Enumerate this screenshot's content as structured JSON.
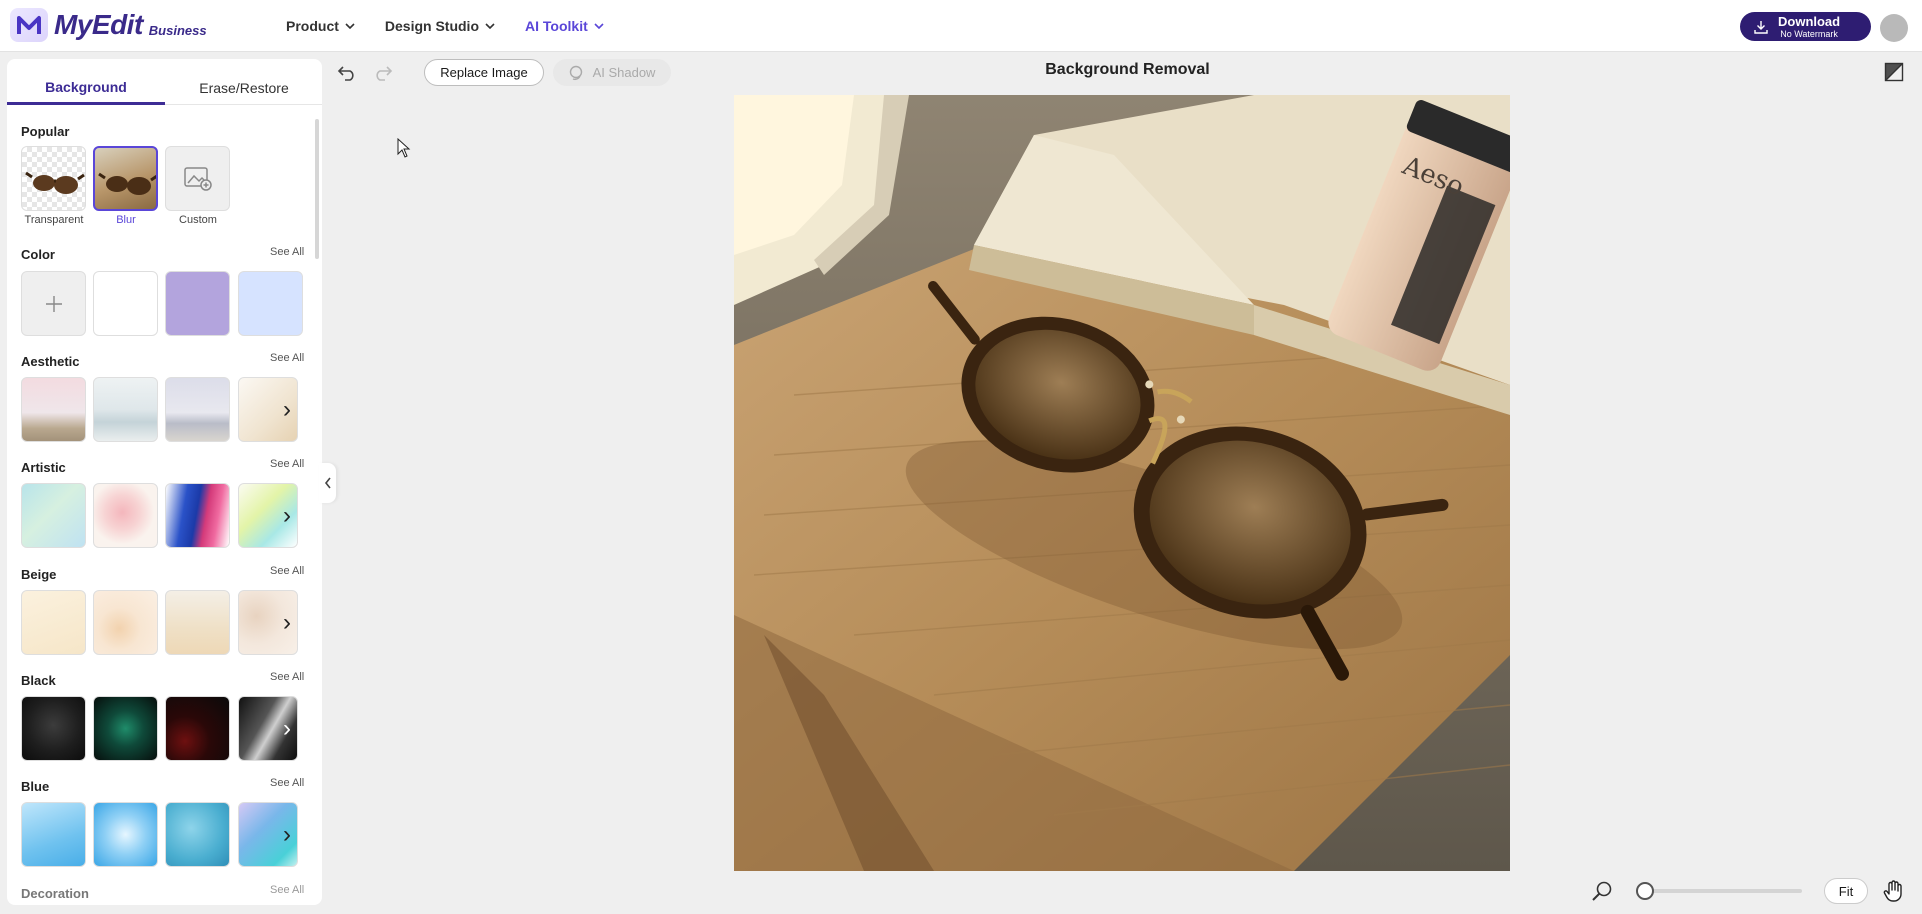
{
  "header": {
    "brand": "MyEdit",
    "brand_sub": "Business",
    "nav": [
      {
        "label": "Product"
      },
      {
        "label": "Design Studio"
      },
      {
        "label": "AI Toolkit"
      }
    ],
    "download_label": "Download",
    "download_sub": "No Watermark"
  },
  "panel": {
    "tabs": [
      "Background",
      "Erase/Restore"
    ],
    "sections": {
      "popular": {
        "title": "Popular",
        "items": [
          "Transparent",
          "Blur",
          "Custom"
        ],
        "selected": "Blur"
      },
      "color": {
        "title": "Color",
        "see_all": "See All",
        "swatches": [
          "#ffffff",
          "#b3a4dd",
          "#d6e3ff"
        ]
      },
      "aesthetic": {
        "title": "Aesthetic",
        "see_all": "See All"
      },
      "artistic": {
        "title": "Artistic",
        "see_all": "See All"
      },
      "beige": {
        "title": "Beige",
        "see_all": "See All"
      },
      "black": {
        "title": "Black",
        "see_all": "See All"
      },
      "blue": {
        "title": "Blue",
        "see_all": "See All"
      },
      "decoration": {
        "title": "Decoration",
        "see_all": "See All"
      }
    }
  },
  "toolbar": {
    "replace_label": "Replace Image",
    "shadow_label": "AI Shadow",
    "title": "Background Removal"
  },
  "bottom": {
    "fit_label": "Fit",
    "zoom_fraction": 0
  },
  "colors": {
    "accent": "#5a46d8",
    "brand_dark": "#2e1d72"
  }
}
